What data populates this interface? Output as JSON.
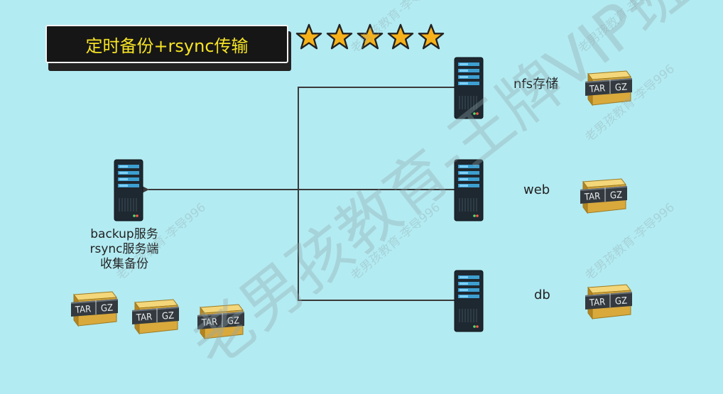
{
  "title": "定时备份+rsync传输",
  "rating_stars": 5,
  "backup_server": {
    "lines": [
      "backup服务",
      "rsync服务端",
      "收集备份"
    ]
  },
  "clients": [
    {
      "label": "nfs存储"
    },
    {
      "label": "web"
    },
    {
      "label": "db"
    }
  ],
  "archive_icon": {
    "left_text": "TAR",
    "right_text": "GZ"
  },
  "watermark": {
    "main": "老男孩教育-王牌VIP班",
    "small": "老男孩教育-李导996"
  },
  "colors": {
    "background": "#b3ebf2",
    "title_text": "#f5e324",
    "title_bg": "#161616",
    "line": "#3a3a3a"
  }
}
